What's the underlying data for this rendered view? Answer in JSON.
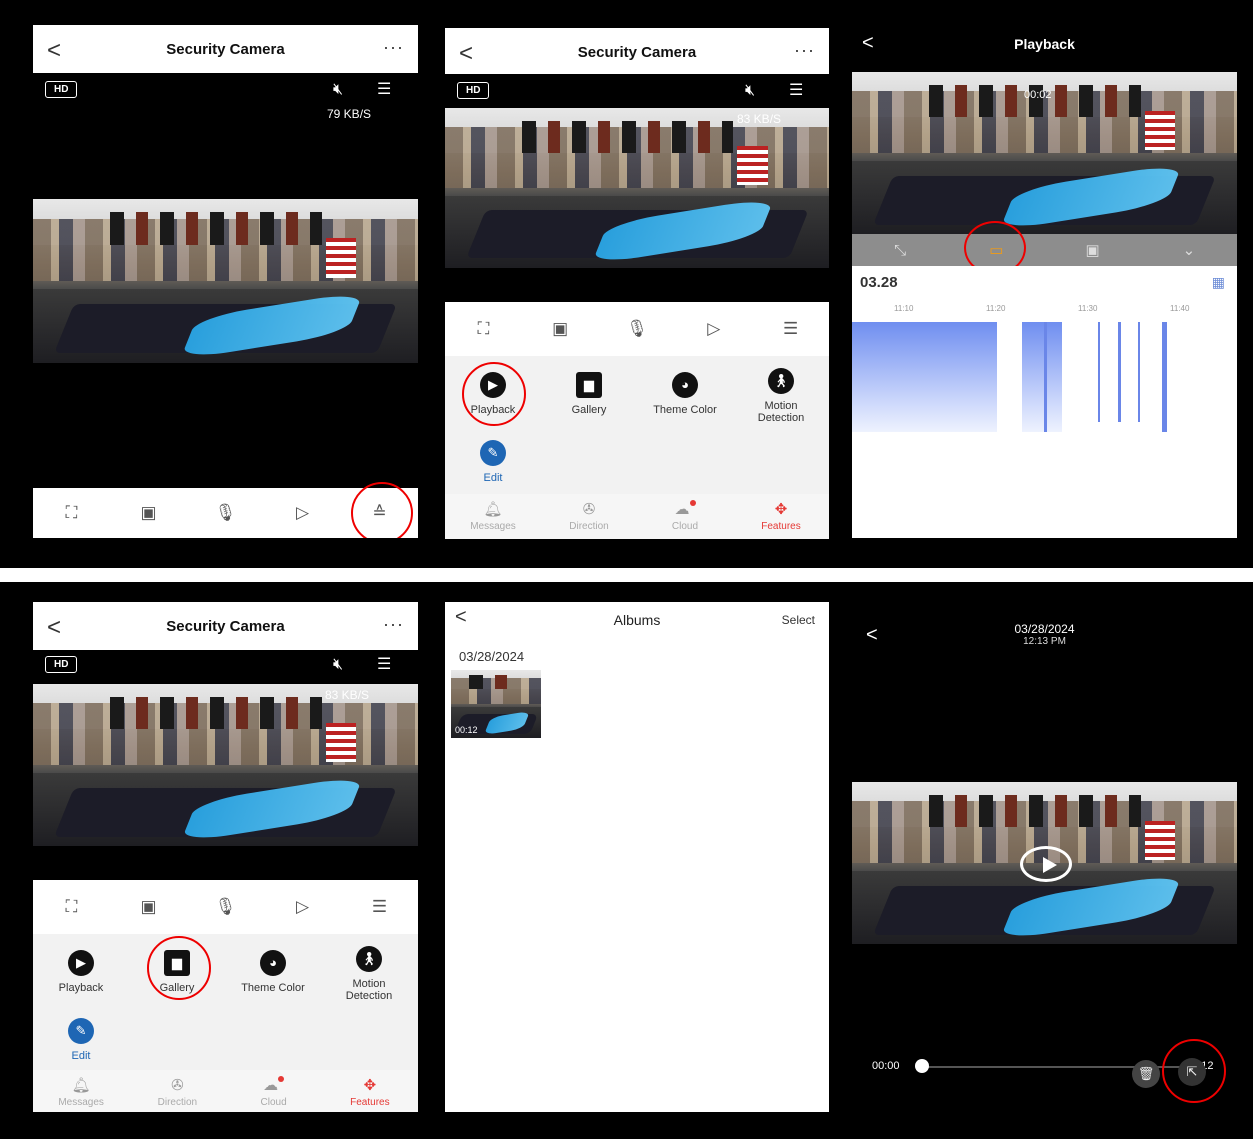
{
  "panel_live": {
    "title": "Security Camera",
    "back": "<",
    "more": "···",
    "hd": "HD",
    "speed": "79 KB/S",
    "mute_icon": "mute-icon",
    "controls": [
      "fullscreen-icon",
      "snapshot-icon",
      "microphone-icon",
      "record-icon",
      "expand-icon"
    ]
  },
  "panel_features": {
    "title": "Security Camera",
    "back": "<",
    "more": "···",
    "hd": "HD",
    "speed": "83 KB/S",
    "features": [
      {
        "label": "Playback",
        "icon": "play-icon"
      },
      {
        "label": "Gallery",
        "icon": "gallery-icon"
      },
      {
        "label": "Theme Color",
        "icon": "palette-icon"
      },
      {
        "label": "Motion Detection",
        "icon": "motion-icon"
      },
      {
        "label": "Edit",
        "icon": "edit-icon"
      }
    ],
    "tabs": [
      {
        "label": "Messages",
        "icon": "bell-icon"
      },
      {
        "label": "Direction",
        "icon": "direction-icon"
      },
      {
        "label": "Cloud",
        "icon": "cloud-icon"
      },
      {
        "label": "Features",
        "icon": "features-icon",
        "active": true
      }
    ]
  },
  "panel_playback": {
    "title": "Playback",
    "back": "<",
    "clip_time": "00:02",
    "date": "03.28",
    "ticks": [
      "11:10",
      "11:20",
      "11:30",
      "11:40"
    ],
    "tools": [
      "shrink-icon",
      "video-record-icon",
      "camera-icon",
      "collapse-icon"
    ],
    "accent": "#f39c12"
  },
  "panel_gallery": {
    "title": "Security Camera",
    "back": "<",
    "more": "···",
    "hd": "HD",
    "speed": "83 KB/S",
    "features": [
      {
        "label": "Playback"
      },
      {
        "label": "Gallery"
      },
      {
        "label": "Theme Color"
      },
      {
        "label": "Motion Detection"
      },
      {
        "label": "Edit"
      }
    ],
    "tabs": [
      {
        "label": "Messages"
      },
      {
        "label": "Direction"
      },
      {
        "label": "Cloud"
      },
      {
        "label": "Features"
      }
    ]
  },
  "panel_albums": {
    "title": "Albums",
    "back": "<",
    "select": "Select",
    "date": "03/28/2024",
    "thumb_duration": "00:12"
  },
  "panel_viewer": {
    "back": "<",
    "date": "03/28/2024",
    "time": "12:13 PM",
    "start": "00:00",
    "end": "00:12",
    "progress": 0
  },
  "highlight_color": "#ee0000"
}
